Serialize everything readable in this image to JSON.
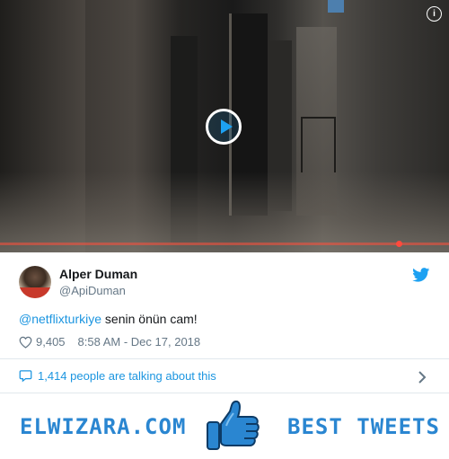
{
  "video": {
    "info_label": "i"
  },
  "tweet": {
    "author_name": "Alper Duman",
    "author_handle": "@ApiDuman",
    "mention": "@netflixturkiye",
    "body": " senin önün cam!",
    "likes": "9,405",
    "timestamp": "8:58 AM - Dec 17, 2018",
    "talking": "1,414 people are talking about this"
  },
  "banner": {
    "left_text": "ELWIZARA.COM",
    "right_text": "BEST TWEETS"
  },
  "colors": {
    "twitter_blue": "#1da1f2",
    "link_blue": "#1b95e0",
    "banner_blue": "#2a86d1",
    "muted_gray": "#657786",
    "progress_red": "#ff4a3d"
  },
  "icons": [
    "info-icon",
    "play-icon",
    "twitter-bird-icon",
    "heart-icon",
    "speech-bubble-icon",
    "chevron-right-icon",
    "thumbs-up-icon"
  ]
}
